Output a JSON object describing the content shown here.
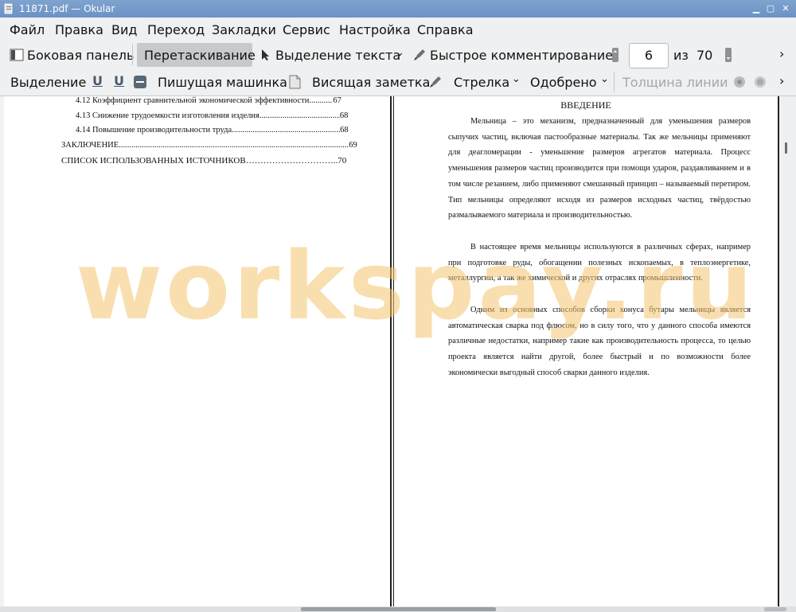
{
  "window": {
    "title": "11871.pdf  — Okular"
  },
  "menu": [
    "Файл",
    "Правка",
    "Вид",
    "Переход",
    "Закладки",
    "Сервис",
    "Настройка",
    "Справка"
  ],
  "toolbar": {
    "sidebar": "Боковая панель",
    "drag": "Перетаскивание",
    "text_select": "Выделение текста",
    "quick_annotate": "Быстрое комментирование",
    "page_current": "6",
    "page_of": "из",
    "page_total": "70"
  },
  "annotation_bar": {
    "highlight": "Выделение",
    "typewriter": "Пишущая машинка",
    "note": "Висящая заметка",
    "arrow": "Стрелка",
    "approved": "Одобрено",
    "line_width": "Толщина линии"
  },
  "left_page": {
    "toc": [
      {
        "title": "4.12 Коэффициент сравнительной экономической эффективности",
        "page": "67"
      },
      {
        "title": "4.13 Снижение трудоемкости изготовления изделия",
        "page": "68"
      },
      {
        "title": "4.14 Повышение производительности труда",
        "page": "68"
      },
      {
        "title": "ЗАКЛЮЧЕНИЕ",
        "page": "69"
      },
      {
        "title": "СПИСОК ИСПОЛЬЗОВАННЫХ ИСТОЧНИКОВ…………………………..",
        "page": "70"
      }
    ]
  },
  "right_page": {
    "heading": "ВВЕДЕНИЕ",
    "paragraphs": [
      "Мельница – это механизм, предназначенный для уменьшения размеров сыпучих частиц, включая пастообразные материалы. Так же мельницы применяют для деагломерации - уменьшение размеров агрегатов материала. Процесс уменьшения размеров частиц производится при помощи ударов, раздавливанием и в том числе резанием, либо применяют смешанный принцип – называемый перетиром. Тип мельницы определяют исходя из размеров исходных частиц, твёрдостью размалываемого материала и производительностью.",
      "В настоящее время мельницы используются в различных сферах, например при подготовке руды, обогащении полезных ископаемых, в теплоэнергетике, металлургии, а так же химической и других отраслях промышленности.",
      "Одним из основных способов сборки конуса бутары мельницы является автоматическая сварка под флюсом, но в силу того, что у данного способа имеются различные недостатки, например такие как производительность процесса, то целью проекта является найти другой, более быстрый и по возможности более экономически выгодный способ сварки данного изделия."
    ]
  },
  "watermark": "workspay.ru",
  "colors": {
    "titlebar": "#7fa3cf",
    "toolbar": "#eff0f1",
    "watermark": "#f4c46e"
  }
}
